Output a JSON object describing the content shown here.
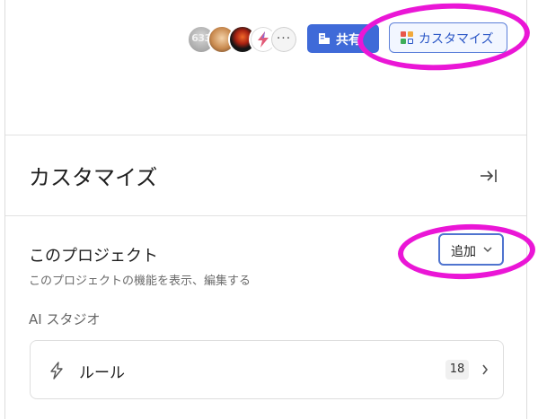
{
  "topbar": {
    "avatar_1_text": "633",
    "more_avatars_glyph": "···",
    "share_label": "共有",
    "customize_label": "カスタマイズ"
  },
  "panel": {
    "title": "カスタマイズ",
    "section": {
      "title": "このプロジェクト",
      "description": "このプロジェクトの機能を表示、編集する",
      "add_label": "追加"
    },
    "studio_label": "AI スタジオ",
    "rules": {
      "label": "ルール",
      "count": "18"
    }
  },
  "colors": {
    "accent": "#3f6ad8",
    "highlight": "#ea16d6"
  },
  "icons": [
    "building-icon",
    "app-grid-icon",
    "collapse-panel-icon",
    "chevron-down-icon",
    "lightning-icon",
    "chevron-right-icon"
  ]
}
